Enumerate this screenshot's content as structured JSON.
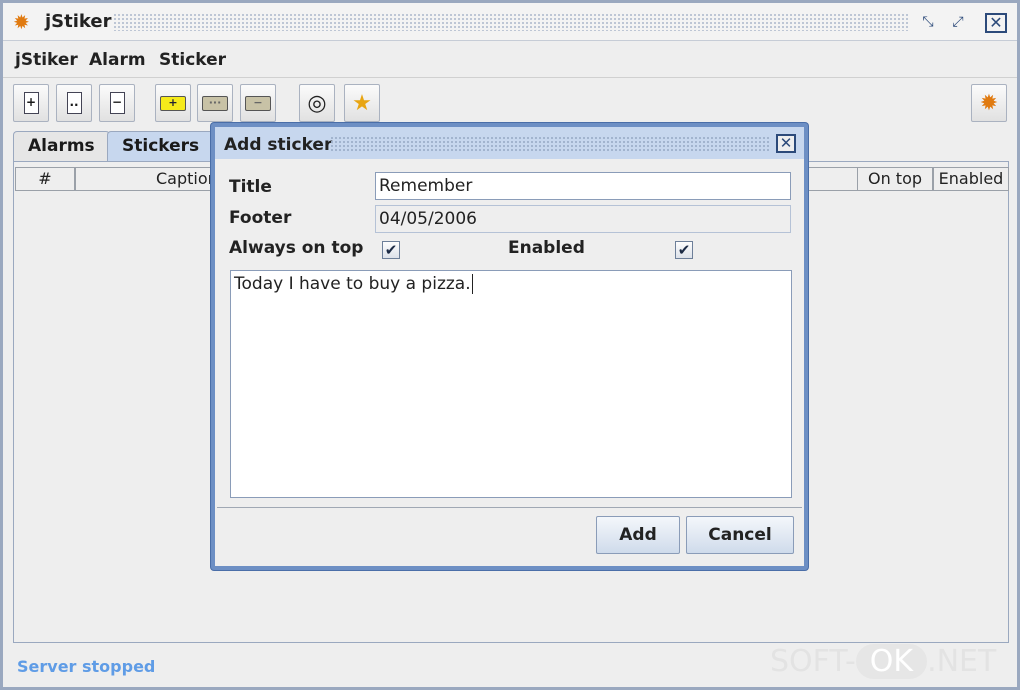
{
  "window": {
    "title": "jStiker",
    "icon": "sun-gear-icon",
    "controls": {
      "minimize": "⤡",
      "maximize": "⤢",
      "close": "✕"
    }
  },
  "menu": [
    "jStiker",
    "Alarm",
    "Sticker"
  ],
  "toolbar": {
    "new_doc": "+",
    "open_doc": "..",
    "remove_doc": "−",
    "add_sticker": "+",
    "edit_sticker": "···",
    "remove_sticker": "−",
    "target": "◎",
    "star": "★",
    "settings": "✹"
  },
  "tabs": [
    "Alarms",
    "Stickers"
  ],
  "table": {
    "headers": [
      "#",
      "Caption",
      "On top",
      "Enabled"
    ]
  },
  "status": "Server stopped",
  "watermark": {
    "left": "SOFT-",
    "mid": "OK",
    "right": ".NET"
  },
  "dialog": {
    "title": "Add sticker",
    "close": "✕",
    "title_label": "Title",
    "title_value": "Remember",
    "footer_label": "Footer",
    "footer_value": "04/05/2006",
    "always_on_top_label": "Always on top",
    "always_on_top_checked": "✔",
    "enabled_label": "Enabled",
    "enabled_checked": "✔",
    "body_text": "Today I have to buy a pizza.",
    "add_button": "Add",
    "cancel_button": "Cancel"
  },
  "colors": {
    "accent": "#6d8fc4",
    "status": "#5f9ce6",
    "tab_active": "#c7d7ee"
  }
}
